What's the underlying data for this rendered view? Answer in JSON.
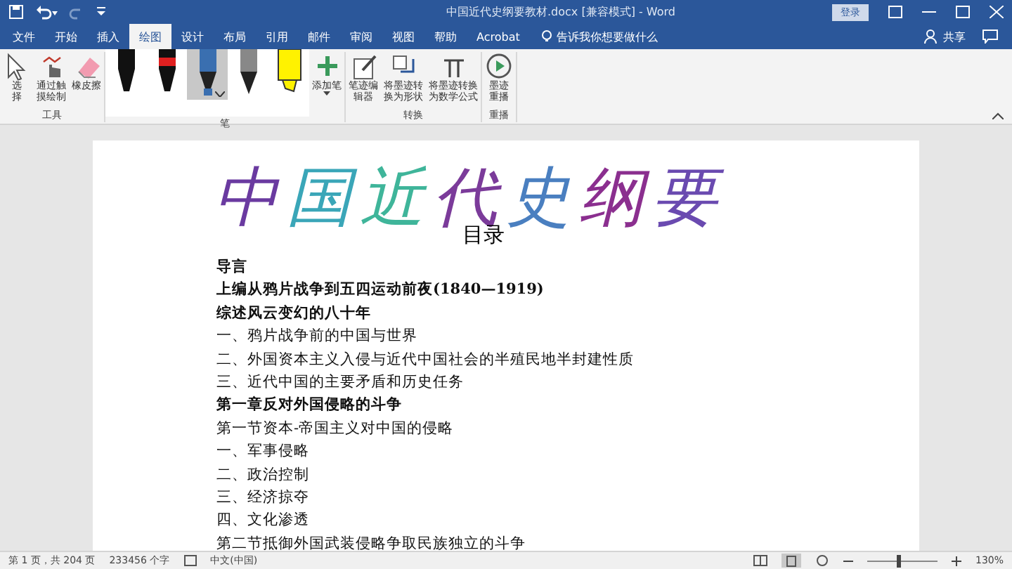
{
  "window": {
    "title": "中国近代史纲要教材.docx [兼容模式] - Word",
    "signin": "登录"
  },
  "tabs": [
    {
      "label": "文件",
      "selected": false
    },
    {
      "label": "开始",
      "selected": false
    },
    {
      "label": "插入",
      "selected": false
    },
    {
      "label": "绘图",
      "selected": true
    },
    {
      "label": "设计",
      "selected": false
    },
    {
      "label": "布局",
      "selected": false
    },
    {
      "label": "引用",
      "selected": false
    },
    {
      "label": "邮件",
      "selected": false
    },
    {
      "label": "审阅",
      "selected": false
    },
    {
      "label": "视图",
      "selected": false
    },
    {
      "label": "帮助",
      "selected": false
    },
    {
      "label": "Acrobat",
      "selected": false
    }
  ],
  "tell_me": "告诉我你想要做什么",
  "share": "共享",
  "ribbon": {
    "groups": [
      {
        "label": "工具",
        "buttons": [
          {
            "kind": "select",
            "label": "选择"
          },
          {
            "kind": "touch",
            "label": "通过触摸绘制"
          },
          {
            "kind": "eraser",
            "label": "橡皮擦"
          }
        ]
      },
      {
        "label": "笔",
        "pens": [
          {
            "kind": "pen",
            "color": "#111111",
            "selected": false
          },
          {
            "kind": "pen",
            "color": "#e02020",
            "selected": false
          },
          {
            "kind": "galaxy",
            "color": "#3a6fb0",
            "selected": true
          },
          {
            "kind": "pencil",
            "color": "#222222",
            "selected": false
          },
          {
            "kind": "highlighter",
            "color": "#fff200",
            "selected": false
          }
        ],
        "buttons": [
          {
            "kind": "add",
            "label": "添加笔"
          }
        ]
      },
      {
        "label": "转换",
        "buttons": [
          {
            "kind": "editor",
            "label": "笔迹编辑器"
          },
          {
            "kind": "shape",
            "label": "将墨迹转换为形状"
          },
          {
            "kind": "math",
            "label": "将墨迹转换为数学公式"
          }
        ]
      },
      {
        "label": "重播",
        "buttons": [
          {
            "kind": "replay",
            "label": "墨迹重播"
          }
        ]
      }
    ]
  },
  "document": {
    "ink_title": "中国近代史纲要",
    "heading": "目录",
    "lines": [
      {
        "text": "导言",
        "bold": true
      },
      {
        "text": "上编从鸦片战争到五四运动前夜(1840—1919)",
        "bold": true
      },
      {
        "text": "综述风云变幻的八十年",
        "bold": true
      },
      {
        "text": "一、鸦片战争前的中国与世界",
        "bold": false
      },
      {
        "text": "二、外国资本主义入侵与近代中国社会的半殖民地半封建性质",
        "bold": false
      },
      {
        "text": "三、近代中国的主要矛盾和历史任务",
        "bold": false
      },
      {
        "text": "第一章反对外国侵略的斗争",
        "bold": true
      },
      {
        "text": "第一节资本-帝国主义对中国的侵略",
        "bold": false
      },
      {
        "text": "一、军事侵略",
        "bold": false
      },
      {
        "text": "二、政治控制",
        "bold": false
      },
      {
        "text": "三、经济掠夺",
        "bold": false
      },
      {
        "text": "四、文化渗透",
        "bold": false
      },
      {
        "text": "第二节抵御外国武装侵略争取民族独立的斗争",
        "bold": false
      }
    ]
  },
  "status_bar": {
    "page": "第 1 页，共 204 页",
    "words": "233456 个字",
    "language": "中文(中国)",
    "zoom": {
      "level": 0.45,
      "label": "130%"
    }
  }
}
